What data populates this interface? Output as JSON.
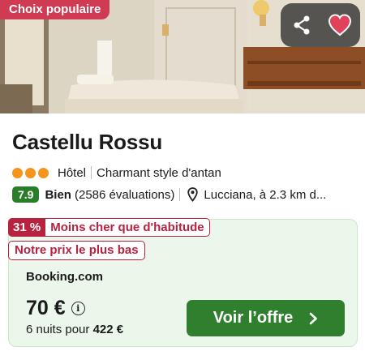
{
  "photo": {
    "badge": "Choix populaire",
    "share_icon": "share-icon",
    "favorite_icon": "heart-icon",
    "favorite_color": "#e0425c"
  },
  "hotel": {
    "name": "Castellu Rossu",
    "stars": 3,
    "type": "Hôtel",
    "tagline": "Charmant style d'antan",
    "score": "7.9",
    "rating_label": "Bien",
    "reviews": "(2586 évaluations)",
    "location_icon": "map-pin-icon",
    "location": "Lucciana, à 2.3 km d..."
  },
  "deal": {
    "discount": "31 %",
    "discount_text": "Moins cher que d'habitude",
    "lowest_price_text": "Notre prix le plus bas",
    "provider": "Booking.com",
    "price": "70 €",
    "nights_prefix": "6 nuits pour",
    "total": "422 €",
    "cta_label": "Voir l’offre"
  },
  "colors": {
    "badge": "#d03a52",
    "accent_red": "#b8223f",
    "score_green": "#2a7d2a",
    "cta_green": "#2f7f2f",
    "deal_bg": "#ebf7eb",
    "star_orange": "#f4941c"
  }
}
